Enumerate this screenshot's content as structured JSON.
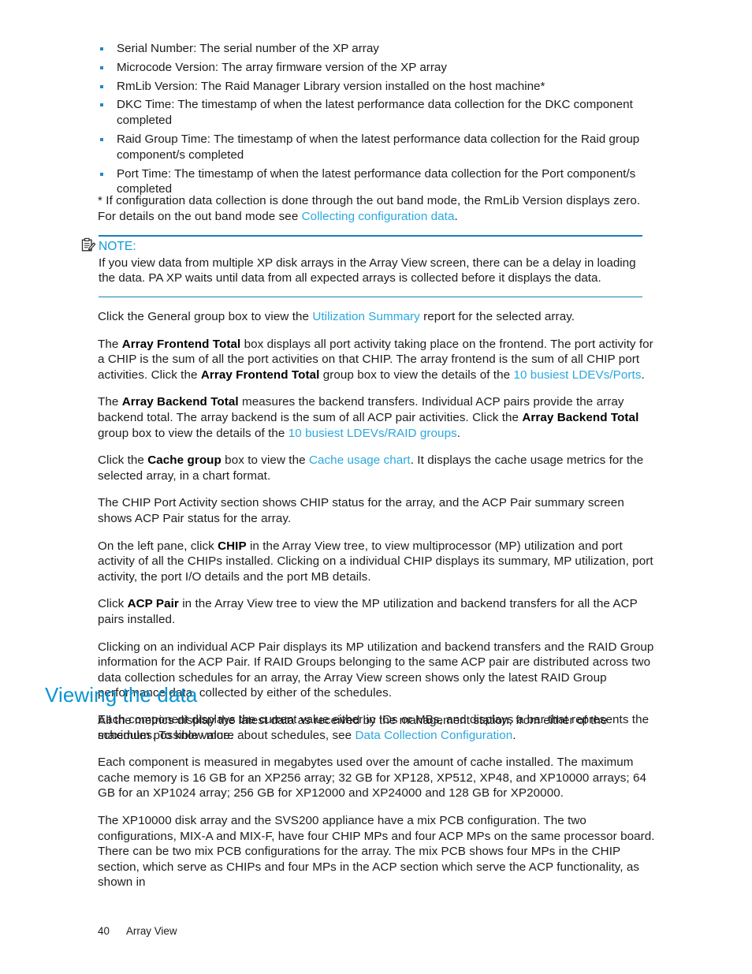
{
  "document": {
    "footer": {
      "page_number": "40",
      "chapter": "Array View"
    }
  },
  "bullets": {
    "items": [
      "Serial Number: The serial number of the XP array",
      "Microcode Version: The array firmware version of the XP array",
      "RmLib Version: The Raid Manager Library version installed on the host machine*",
      "DKC Time: The timestamp of when the latest performance data collection for the DKC component completed",
      "Raid Group Time: The timestamp of when the latest performance data collection for the Raid group component/s completed",
      "Port Time: The timestamp of when the latest performance data collection for the Port component/s completed"
    ]
  },
  "footnote": {
    "text_before": "* If configuration data collection is done through the out band mode, the RmLib Version displays zero. For details on the out band mode see ",
    "link": "Collecting configuration data",
    "text_after": "."
  },
  "note": {
    "icon": "note-clipboard-icon",
    "title": "NOTE:",
    "body": "If you view data from multiple XP disk arrays in the Array View screen, there can be a delay in loading the data. PA XP waits until data from all expected arrays is collected before it displays the data."
  },
  "paragraphs": {
    "general_group": {
      "p1": "Click the General group box to view the ",
      "link1": "Utilization Summary",
      "p2": " report for the selected array."
    },
    "array_frontend": {
      "p1": "The ",
      "b1": "Array Frontend Total",
      "p2": " box displays all port activity taking place on the frontend. The port activity for a CHIP is the sum of all the port activities on that CHIP. The array frontend is the sum of all CHIP port activities. Click the ",
      "b2": "Array Frontend Total",
      "p3": " group box to view the details of the ",
      "link1": "10 busiest LDEVs/Ports",
      "p4": "."
    },
    "array_backend": {
      "p1": "The ",
      "b1": "Array Backend Total",
      "p2": " measures the backend transfers. Individual ACP pairs provide the array backend total. The array backend is the sum of all ACP pair activities. Click the ",
      "b2": "Array Backend Total",
      "p3": " group box to view the details of the ",
      "link1": "10 busiest LDEVs/RAID groups",
      "p4": "."
    },
    "cache_group": {
      "p1": "Click the ",
      "b1": "Cache group",
      "p2": " box to view the ",
      "link1": "Cache usage chart",
      "p3": ". It displays the cache usage metrics for the selected array, in a chart format."
    },
    "chip_port_activity": {
      "p1": "The CHIP Port Activity section shows CHIP status for the array, and the ACP Pair summary screen shows ACP Pair status for the array."
    },
    "chip_tree": {
      "p1": "On the left pane, click ",
      "b1": "CHIP",
      "p2": " in the Array View tree, to view multiprocessor (MP) utilization and port activity of all the CHIPs installed. Clicking on a individual CHIP displays its summary, MP utilization, port activity, the port I/O details and the port MB details."
    },
    "acp_pair_tree": {
      "p1": "Click ",
      "b1": "ACP Pair",
      "p2": " in the Array View tree to view the MP utilization and backend transfers for all the ACP pairs installed."
    },
    "acp_pair_individual": {
      "p1": "Clicking on an individual ACP Pair displays its MP utilization and backend transfers and the RAID Group information for the ACP Pair. If RAID Groups belonging to the same ACP pair are distributed across two data collection schedules for an array, the Array View screen shows only the latest RAID Group performance data, collected by either of the schedules."
    },
    "metrics_latest": {
      "p1": "All the metrics display the latest data as received by the management station, from either of the schedules. To know more about schedules, see ",
      "link1": "Data Collection Configuration",
      "p2": "."
    }
  },
  "section": {
    "heading": "Viewing the data",
    "paragraphs": {
      "component_value": "Each component displays the current value either in IOs or MBs, and displays a bar that represents the maximum possible value.",
      "cache_memory": "Each component is measured in megabytes used over the amount of cache installed. The maximum cache memory is 16 GB for an XP256 array; 32 GB for XP128, XP512, XP48, and XP10000 arrays; 64 GB for an XP1024 array; 256 GB for XP12000 and XP24000 and 128 GB for XP20000.",
      "mix_pcb": "The XP10000 disk array and the SVS200 appliance have a mix PCB configuration. The two configurations, MIX-A and MIX-F, have four CHIP MPs and four ACP MPs on the same processor board. There can be two mix PCB configurations for the array. The mix PCB shows four MPs in the CHIP section, which serve as CHIPs and four MPs in the ACP section which serve the ACP functionality, as shown in"
    }
  },
  "colors": {
    "link": "#29a8df",
    "heading": "#0b95d2",
    "bullet": "#2089c8",
    "rule": "#1b7fb5"
  }
}
